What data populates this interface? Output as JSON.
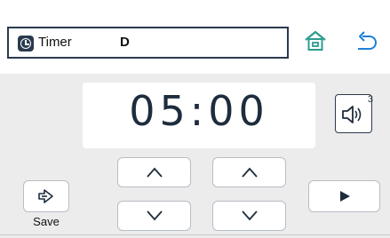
{
  "header": {
    "title": "Timer",
    "code": "D"
  },
  "timer": {
    "display": "05:00"
  },
  "volume": {
    "level": "3"
  },
  "actions": {
    "save_label": "Save"
  },
  "icons": {
    "header": [
      "clock-icon",
      "home-icon",
      "back-arrow-icon"
    ],
    "controls": [
      "speaker-icon",
      "save-icon",
      "chevron-up-icon",
      "chevron-down-icon",
      "play-icon"
    ]
  },
  "colors": {
    "accent": "#2a3a4e",
    "home_icon": "#2d9c8f",
    "back_icon": "#1c7fd6",
    "panel": "#ececec"
  }
}
